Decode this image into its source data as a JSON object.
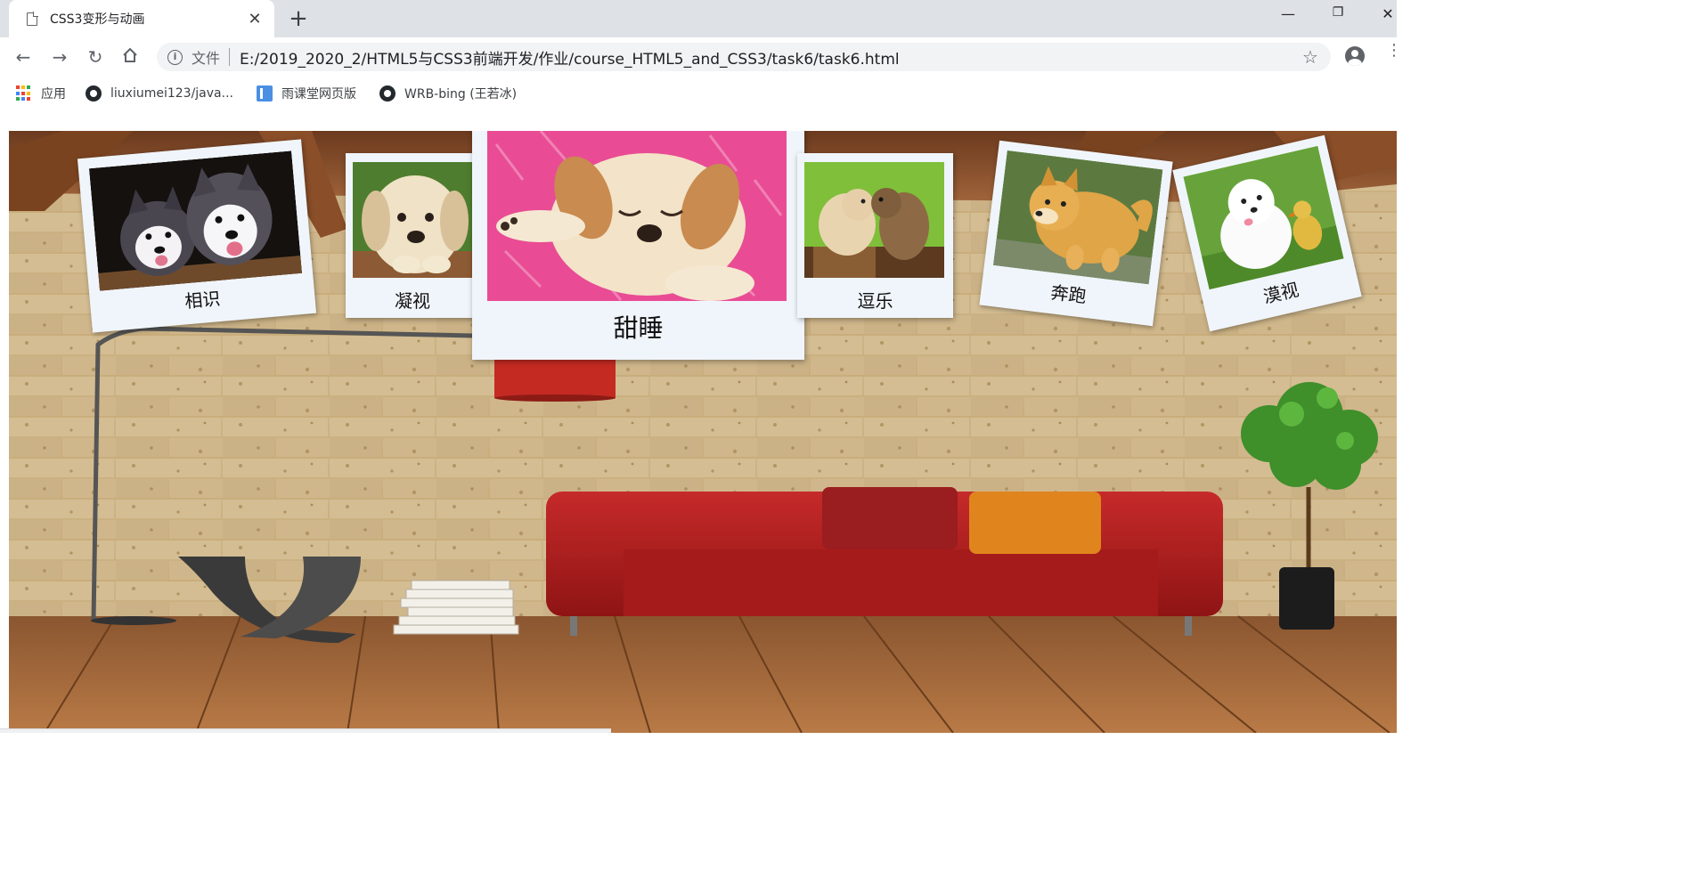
{
  "browser": {
    "tab_title": "CSS3变形与动画",
    "scheme_label": "文件",
    "url": "E:/2019_2020_2/HTML5与CSS3前端开发/作业/course_HTML5_and_CSS3/task6/task6.html"
  },
  "bookmarks": [
    {
      "label": "应用",
      "icon": "apps-grid-icon"
    },
    {
      "label": "liuxiumei123/java...",
      "icon": "github-icon"
    },
    {
      "label": "雨课堂网页版",
      "icon": "yuketang-icon"
    },
    {
      "label": "WRB-bing (王若冰)",
      "icon": "github-icon"
    }
  ],
  "photos": [
    {
      "caption": "相识"
    },
    {
      "caption": "凝视"
    },
    {
      "caption": "甜睡"
    },
    {
      "caption": "逗乐"
    },
    {
      "caption": "奔跑"
    },
    {
      "caption": "漠视"
    }
  ],
  "colors": {
    "tabbar_bg": "#dee1e6",
    "omnibox_bg": "#f1f3f4",
    "polaroid_bg": "#f0f5fb",
    "sofa_red": "#b51d1f",
    "pillow_orange": "#e0851d"
  }
}
